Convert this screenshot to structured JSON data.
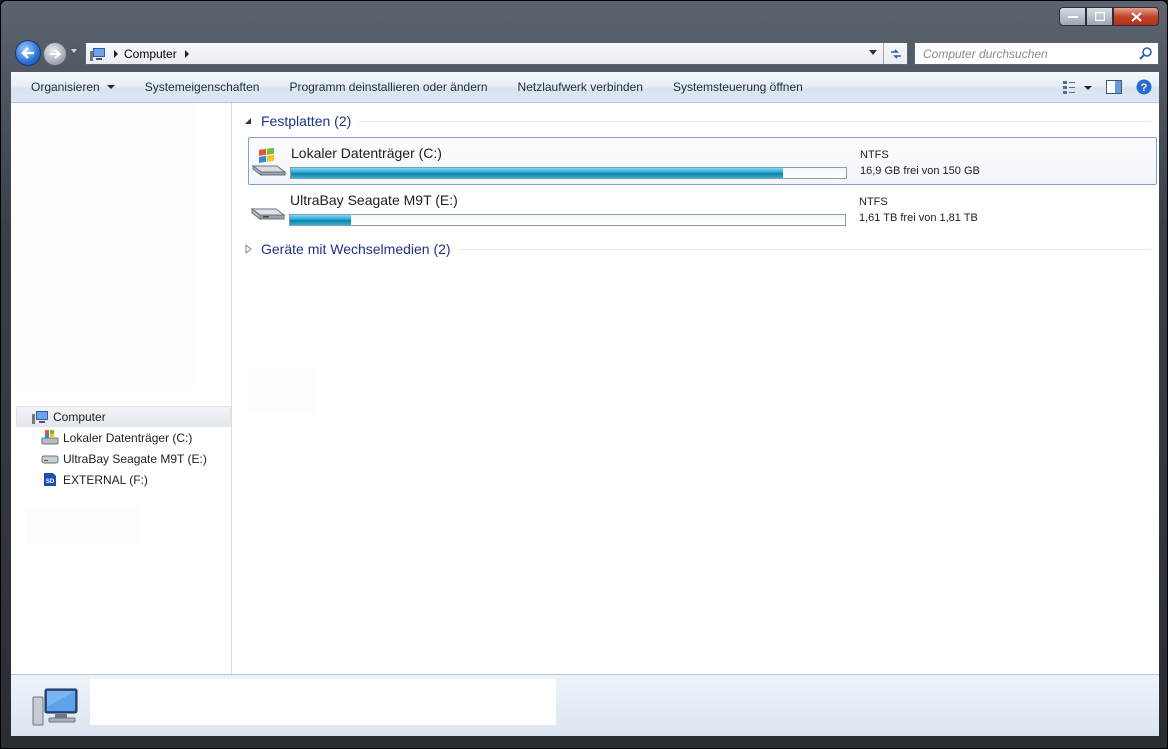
{
  "window": {
    "buttons": [
      "minimize",
      "maximize",
      "close"
    ]
  },
  "address": {
    "crumbs": [
      "Computer"
    ],
    "search_placeholder": "Computer durchsuchen"
  },
  "toolbar": {
    "organize": "Organisieren",
    "system_properties": "Systemeigenschaften",
    "uninstall": "Programm deinstallieren oder ändern",
    "map_drive": "Netzlaufwerk verbinden",
    "control_panel": "Systemsteuerung öffnen"
  },
  "nav": {
    "root": "Computer",
    "items": [
      {
        "label": "Lokaler Datenträger (C:)",
        "icon": "windows-drive-icon"
      },
      {
        "label": "UltraBay Seagate M9T (E:)",
        "icon": "hard-drive-icon"
      },
      {
        "label": "EXTERNAL (F:)",
        "icon": "sd-card-icon"
      }
    ]
  },
  "groups": [
    {
      "label": "Festplatten (2)",
      "expanded": true
    },
    {
      "label": "Geräte mit Wechselmedien (2)",
      "expanded": false
    }
  ],
  "drives": [
    {
      "name": "Lokaler Datenträger (C:)",
      "fs": "NTFS",
      "free_text": "16,9 GB frei von 150 GB",
      "used_fraction": 0.887
    },
    {
      "name": "UltraBay Seagate M9T (E:)",
      "fs": "NTFS",
      "free_text": "1,61 TB frei von 1,81 TB",
      "used_fraction": 0.11
    }
  ],
  "colors": {
    "accent": "#1e3287",
    "bar_fill": "#26a6cf"
  }
}
